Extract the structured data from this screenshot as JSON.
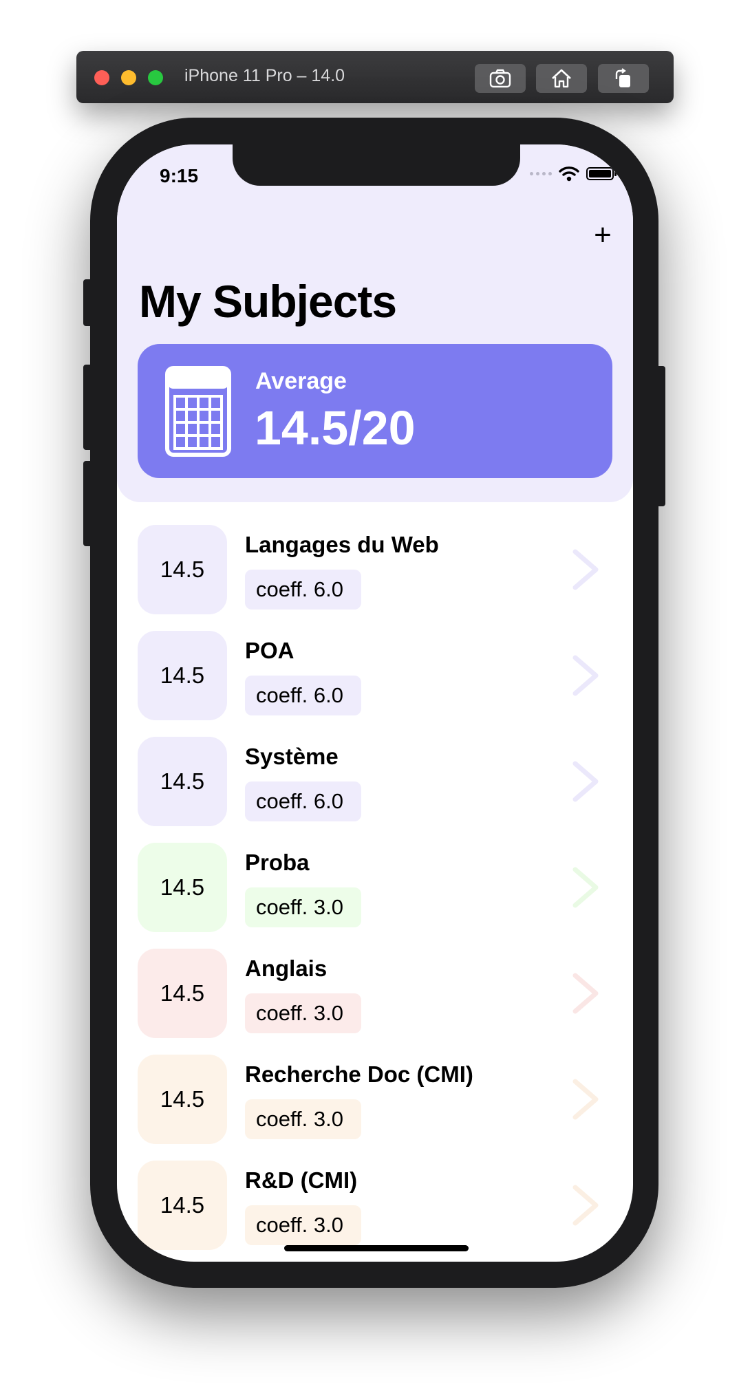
{
  "simulator": {
    "title": "iPhone 11 Pro – 14.0",
    "buttons": [
      "screenshot",
      "home",
      "rotate"
    ]
  },
  "status_bar": {
    "time": "9:15"
  },
  "header": {
    "add_label": "+",
    "title": "My Subjects"
  },
  "average_card": {
    "label": "Average",
    "value": "14.5/20",
    "icon": "calculator-icon",
    "color": "#7d7bf0"
  },
  "colors": {
    "purple_bg": "#efecfc",
    "green_bg": "#edfde9",
    "red_bg": "#fcebea",
    "orange_bg": "#fdf3e8"
  },
  "subjects": [
    {
      "grade": "14.5",
      "name": "Langages du Web",
      "coeff": "coeff. 6.0",
      "theme": "purple"
    },
    {
      "grade": "14.5",
      "name": "POA",
      "coeff": "coeff. 6.0",
      "theme": "purple"
    },
    {
      "grade": "14.5",
      "name": "Système",
      "coeff": "coeff. 6.0",
      "theme": "purple"
    },
    {
      "grade": "14.5",
      "name": "Proba",
      "coeff": "coeff. 3.0",
      "theme": "green"
    },
    {
      "grade": "14.5",
      "name": "Anglais",
      "coeff": "coeff. 3.0",
      "theme": "red"
    },
    {
      "grade": "14.5",
      "name": "Recherche Doc (CMI)",
      "coeff": "coeff. 3.0",
      "theme": "orange"
    },
    {
      "grade": "14.5",
      "name": "R&D (CMI)",
      "coeff": "coeff. 3.0",
      "theme": "orange"
    }
  ]
}
